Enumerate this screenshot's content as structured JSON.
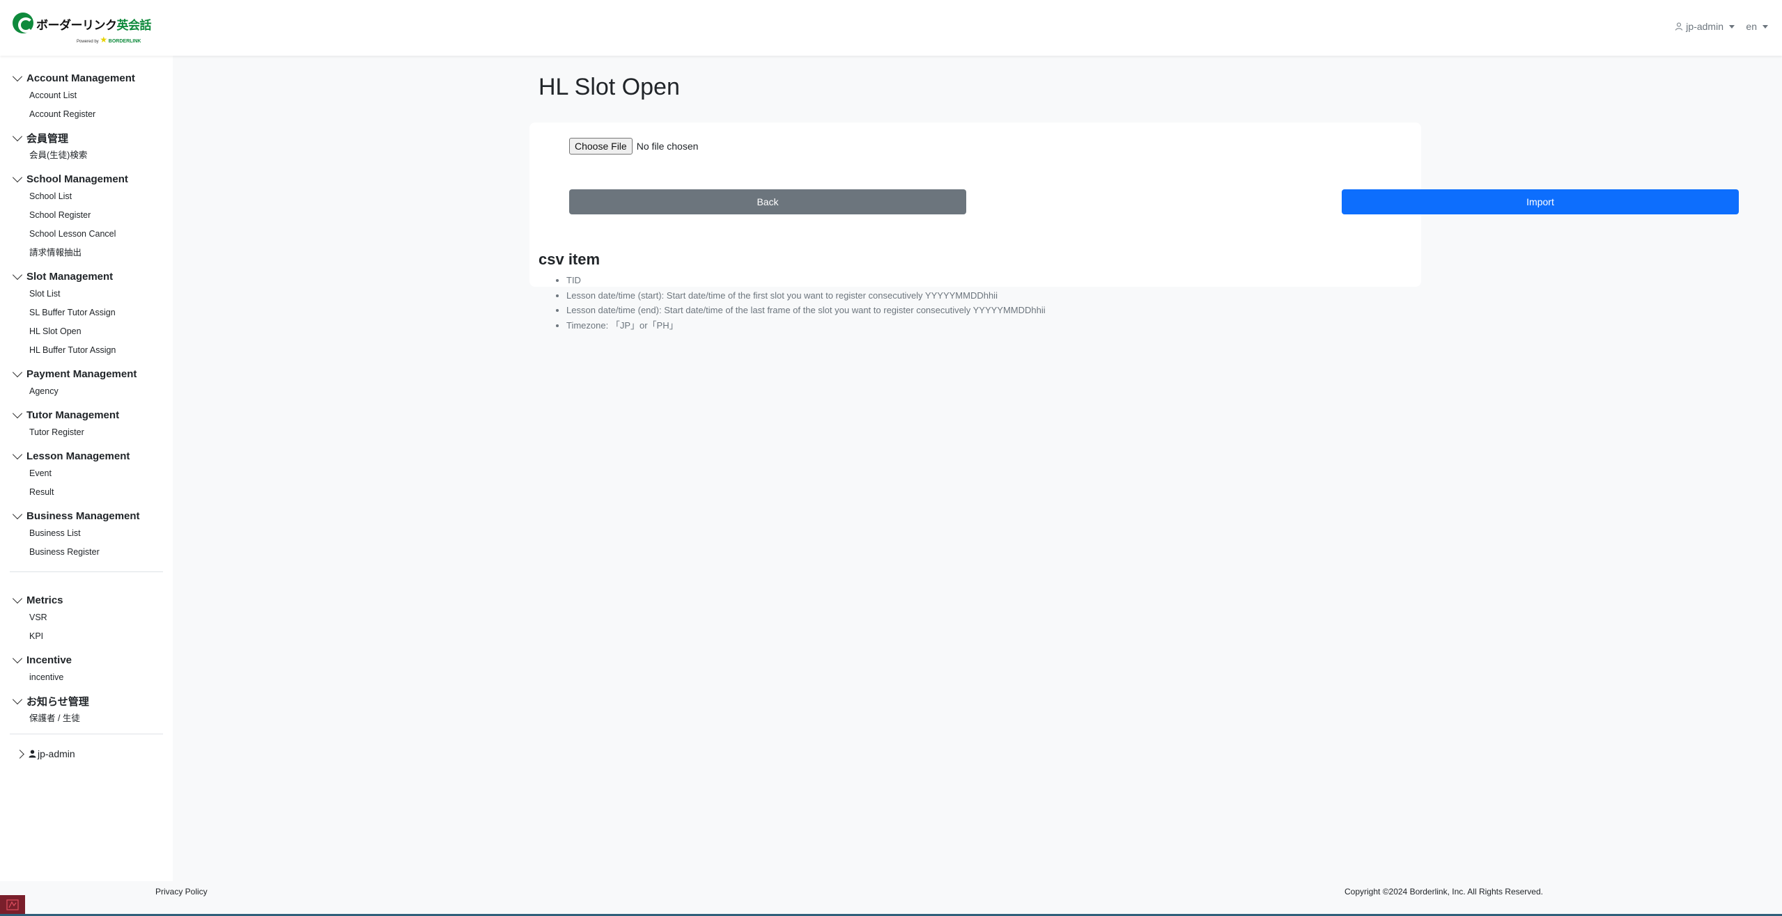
{
  "header": {
    "logo_main_black": "ボーダーリンク",
    "logo_main_green": "英会話",
    "logo_powered_prefix": "Powered by",
    "logo_powered_brand": "BORDERLINK",
    "user_label": "jp-admin",
    "lang_label": "en"
  },
  "sidebar": {
    "sections": [
      {
        "title": "Account Management",
        "items": [
          "Account List",
          "Account Register"
        ]
      },
      {
        "title": "会員管理",
        "items": [
          "会員(生徒)検索"
        ]
      },
      {
        "title": "School Management",
        "items": [
          "School List",
          "School Register",
          "School Lesson Cancel",
          "請求情報抽出"
        ]
      },
      {
        "title": "Slot Management",
        "items": [
          "Slot List",
          "SL Buffer Tutor Assign",
          "HL Slot Open",
          "HL Buffer Tutor Assign"
        ]
      },
      {
        "title": "Payment Management",
        "items": [
          "Agency"
        ]
      },
      {
        "title": "Tutor Management",
        "items": [
          "Tutor Register"
        ]
      },
      {
        "title": "Lesson Management",
        "items": [
          "Event",
          "Result"
        ]
      },
      {
        "title": "Business Management",
        "items": [
          "Business List",
          "Business Register"
        ]
      }
    ],
    "sections2": [
      {
        "title": "Metrics",
        "items": [
          "VSR",
          "KPI"
        ]
      },
      {
        "title": "Incentive",
        "items": [
          "incentive"
        ]
      },
      {
        "title": "お知らせ管理",
        "items": [
          "保護者 / 生徒"
        ]
      }
    ],
    "footer_user": "jp-admin"
  },
  "main": {
    "title": "HL Slot Open",
    "choose_file_label": "Choose File",
    "no_file_text": "No file chosen",
    "back_label": "Back",
    "import_label": "Import",
    "csv_heading": "csv item",
    "csv_items": [
      "TID",
      "Lesson date/time (start): Start date/time of the first slot you want to register consecutively YYYYYMMDDhhii",
      "Lesson date/time (end): Start date/time of the last frame of the slot you want to register consecutively YYYYYMMDDhhii",
      "Timezone: 「JP」or「PH」"
    ]
  },
  "footer": {
    "privacy": "Privacy Policy",
    "copyright": "Copyright ©2024 Borderlink, Inc. All Rights Reserved."
  },
  "colors": {
    "brand_green": "#0f8a3c",
    "primary": "#0d6efd",
    "secondary": "#6c757d"
  }
}
